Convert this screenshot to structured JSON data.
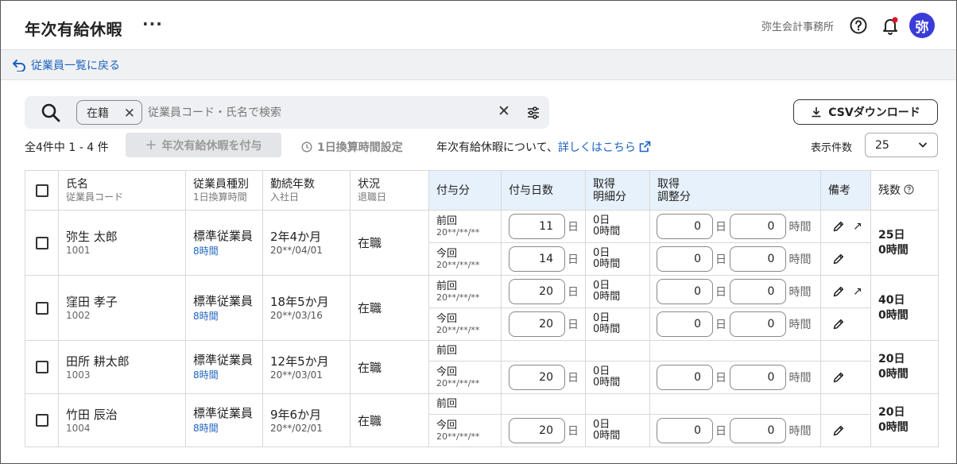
{
  "header": {
    "title": "年次有給休暇",
    "more": "···",
    "company": "弥生会計事務所",
    "avatar": "弥"
  },
  "nav": {
    "back_label": "従業員一覧に戻る"
  },
  "search": {
    "chip_label": "在籍",
    "placeholder": "従業員コード・氏名で検索"
  },
  "toolbar": {
    "csv_label": "CSVダウンロード",
    "count_label": "全4件中 1 - 4 件",
    "grant_label": "年次有給休暇を付与",
    "hour_setting_label": "1日換算時間設定",
    "about_text": "年次有給休暇について、",
    "about_link": "詳しくはこちら",
    "perpage_label": "表示件数",
    "perpage_value": "25"
  },
  "table": {
    "headers": {
      "name": "氏名",
      "name_sub": "従業員コード",
      "type": "従業員種別",
      "type_sub": "1日換算時間",
      "years": "勤続年数",
      "years_sub": "入社日",
      "status": "状況",
      "status_sub": "退職日",
      "grant": "付与分",
      "grant_days": "付与日数",
      "taken1": "取得",
      "taken1b": "明細分",
      "taken2": "取得",
      "taken2b": "調整分",
      "notes": "備考",
      "remain": "残数"
    },
    "units": {
      "day": "日",
      "hour": "時間"
    },
    "rows": [
      {
        "name": "弥生 太郎",
        "code": "1001",
        "type": "標準従業員",
        "hours": "8時間",
        "years": "2年4か月",
        "joined": "20**/04/01",
        "status": "在職",
        "remain_days": "25日",
        "remain_hours": "0時間",
        "prev": {
          "label": "前回",
          "date": "20**/**/**",
          "days": "11",
          "detail_d": "0日",
          "detail_h": "0時間",
          "adj_d": "0",
          "adj_h": "0"
        },
        "curr": {
          "label": "今回",
          "date": "20**/**/**",
          "days": "14",
          "detail_d": "0日",
          "detail_h": "0時間",
          "adj_d": "0",
          "adj_h": "0"
        }
      },
      {
        "name": "窪田 孝子",
        "code": "1002",
        "type": "標準従業員",
        "hours": "8時間",
        "years": "18年5か月",
        "joined": "20**/03/16",
        "status": "在職",
        "remain_days": "40日",
        "remain_hours": "0時間",
        "prev": {
          "label": "前回",
          "date": "20**/**/**",
          "days": "20",
          "detail_d": "0日",
          "detail_h": "0時間",
          "adj_d": "0",
          "adj_h": "0"
        },
        "curr": {
          "label": "今回",
          "date": "20**/**/**",
          "days": "20",
          "detail_d": "0日",
          "detail_h": "0時間",
          "adj_d": "0",
          "adj_h": "0"
        }
      },
      {
        "name": "田所 耕太郎",
        "code": "1003",
        "type": "標準従業員",
        "hours": "8時間",
        "years": "12年5か月",
        "joined": "20**/03/01",
        "status": "在職",
        "remain_days": "20日",
        "remain_hours": "0時間",
        "prev": {
          "label": "前回"
        },
        "curr": {
          "label": "今回",
          "date": "20**/**/**",
          "days": "20",
          "detail_d": "0日",
          "detail_h": "0時間",
          "adj_d": "0",
          "adj_h": "0"
        }
      },
      {
        "name": "竹田 辰治",
        "code": "1004",
        "type": "標準従業員",
        "hours": "8時間",
        "years": "9年6か月",
        "joined": "20**/02/01",
        "status": "在職",
        "remain_days": "20日",
        "remain_hours": "0時間",
        "prev": {
          "label": "前回"
        },
        "curr": {
          "label": "今回",
          "date": "20**/**/**",
          "days": "20",
          "detail_d": "0日",
          "detail_h": "0時間",
          "adj_d": "0",
          "adj_h": "0"
        }
      }
    ]
  },
  "colors": {
    "accent": "#1c63c0",
    "avatar_bg": "#3a3cd8",
    "grant_header_bg": "#e7f1fb"
  }
}
